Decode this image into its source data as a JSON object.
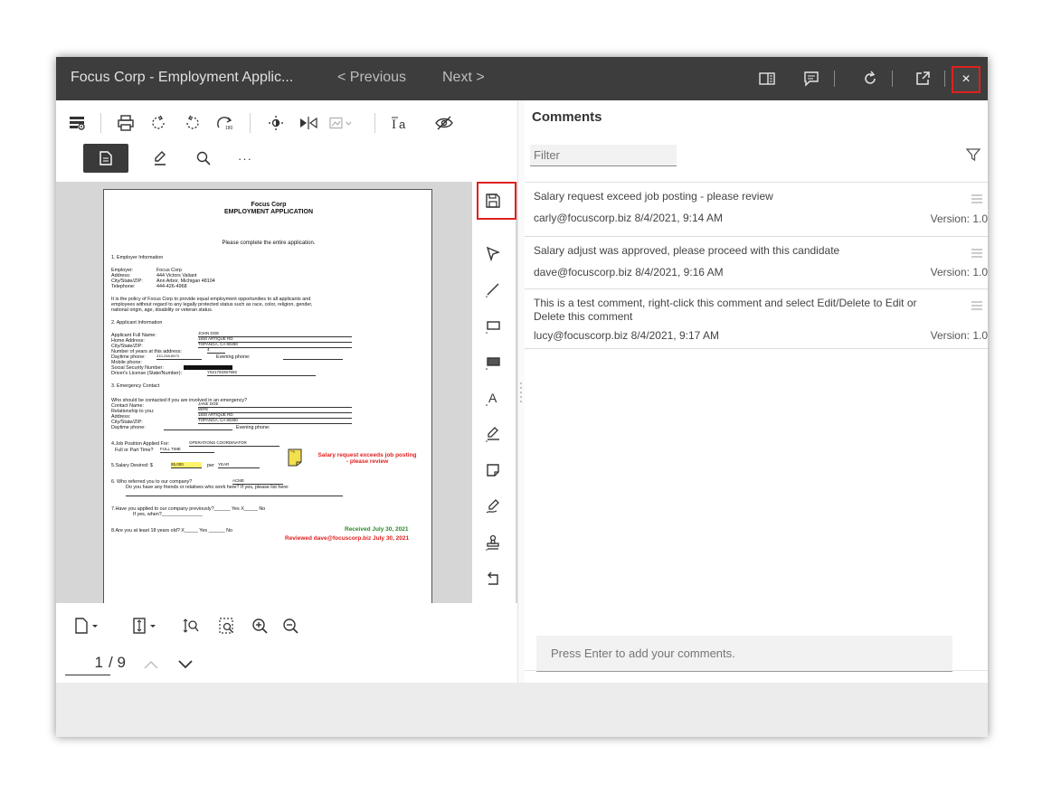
{
  "window": {
    "title": "Focus Corp - Employment Applic...",
    "prev_label": "< Previous",
    "next_label": "Next >",
    "close_label": "×"
  },
  "document": {
    "company": "Focus Corp",
    "heading": "EMPLOYMENT APPLICATION",
    "instruction": "Please complete the entire application.",
    "s1": "1.     Employer Information",
    "employer_label": "Employer:",
    "employer_value": "Focus Corp",
    "address_label": "Address:",
    "address_value": "444 Victors Valiant",
    "csz_label": "City/State/ZIP:",
    "csz_value": "Ann Arbor, Michigan 48104",
    "tel_label": "Telephone:",
    "tel_value": "444-426-4968",
    "policy1": "It is the policy of Focus Corp to provide equal employment opportunities to all applicants and",
    "policy2": "employees without regard to any legally protected status such as race, color, religion, gender,",
    "policy3": "national origin, age, disability or veteran status.",
    "s2": "2.     Applicant Information",
    "app_name_label": "Applicant Full Name:",
    "app_name_value": "JOHN DOE",
    "home_label": "Home Address:",
    "home_value": "1830 ARTIQUE RD",
    "app_csz_label": "City/State/ZIP:",
    "app_csz_value": "TOPANGA, CA 90290",
    "years_label": "Number of years at this address:",
    "years_value": "4",
    "day_phone_label": "Daytime phone:",
    "day_phone_value": "310-248-6573",
    "eve_phone_label": "Evening phone:",
    "mobile_label": "Mobile phone:",
    "ssn_label": "Social Security Number:",
    "dl_label": "Driver's License (State/Number):",
    "dl_value": "Y521793367692",
    "s3": "3.     Emergency Contact",
    "emerg_q": "Who should be contacted if you are involved in an emergency?",
    "contact_label": "Contact Name:",
    "contact_value": "JANE DOE",
    "rel_label": "Relationship to you:",
    "rel_value": "WIFE",
    "e_addr_label": "Address:",
    "e_addr_value": "1830 ARTIQUE RD",
    "e_csz_label": "City/State/ZIP:",
    "e_csz_value": "TOPANGA, CA 90290",
    "e_day_label": "Daytime phone:",
    "e_eve_label": "Evening phone:",
    "job_label": "4.Job Position Applied For:",
    "job_value": "OPERATIONS COORDINATOR",
    "fullpart_label": "Full or Part Time?",
    "fullpart_value": "FULL TIME",
    "salary_label": "5.Salary Desired:  $",
    "salary_value": "85,000",
    "per_label": "per",
    "per_value": "YEAR",
    "salary_note": "Salary request exceeds job posting - please review",
    "s6": "6.     Who referred you to our company?",
    "s6_value": "ACME",
    "s6b": "Do you have any friends or relatives who work here? If yes, please list here:",
    "s7": "7.Have you applied to our company previously?______ Yes  X_____ No",
    "s7b": "If yes, when?_______________",
    "s8": "8.Are you at least 18 years old?  X_____ Yes  ______ No",
    "received": "Received July 30, 2021",
    "reviewed": "Reviewed dave@focuscorp.biz July 30, 2021"
  },
  "pager": {
    "current": "1",
    "total": "/ 9"
  },
  "comments_panel": {
    "title": "Comments",
    "filter_placeholder": "Filter",
    "add_placeholder": "Press Enter to add your comments.",
    "items": [
      {
        "text": "Salary request exceed job posting - please review",
        "author": "carly@focuscorp.biz",
        "date": "8/4/2021, 9:14 AM",
        "version": "Version: 1.0"
      },
      {
        "text": "Salary adjust was approved, please proceed with this candidate",
        "author": "dave@focuscorp.biz",
        "date": "8/4/2021, 9:16 AM",
        "version": "Version: 1.0"
      },
      {
        "text": "This is a test comment, right-click this comment and select Edit/Delete to Edit or Delete this comment",
        "author": "lucy@focuscorp.biz",
        "date": "8/4/2021, 9:17 AM",
        "version": "Version: 1.0"
      }
    ]
  },
  "colors": {
    "titlebar": "#3d3d3d",
    "highlight_red": "#e0201f",
    "note_red": "#e0201f",
    "received_green": "#2a8a2a"
  }
}
